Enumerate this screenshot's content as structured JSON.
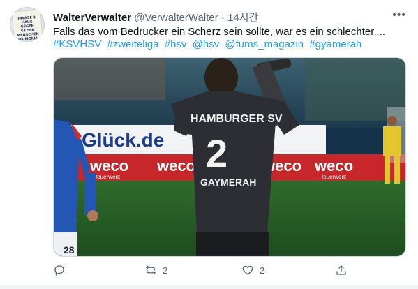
{
  "tweet": {
    "display_name": "WalterVerwalter",
    "handle": "@VerwalterWalter",
    "separator": "·",
    "time": "14시간",
    "text": "Falls das vom Bedrucker ein Scherz sein sollte, war es ein schlechter....",
    "hashtags": [
      "#KSVHSV",
      "#zweiteliga",
      "#hsv",
      "@hsv",
      "@fums_magazin",
      "#gyamerah"
    ],
    "avatar_sign_text": [
      "INVASE 1 HAUS",
      "GEGEN",
      "€3.500 MENSCHEN",
      "AUS MORIA !"
    ]
  },
  "media": {
    "banner_glueck": "Glück.de",
    "banner_weco": "weco",
    "banner_feuerwerk": "feuerwerk",
    "jersey_club": "HAMBURGER SV",
    "jersey_number": "2",
    "jersey_name": "GAYMERAH",
    "left_player_number": "28"
  },
  "actions": {
    "reply_count": "",
    "retweet_count": "2",
    "like_count": "2"
  },
  "colors": {
    "link": "#1d9bf0",
    "muted": "#536471",
    "weco_red": "#d3262b"
  }
}
